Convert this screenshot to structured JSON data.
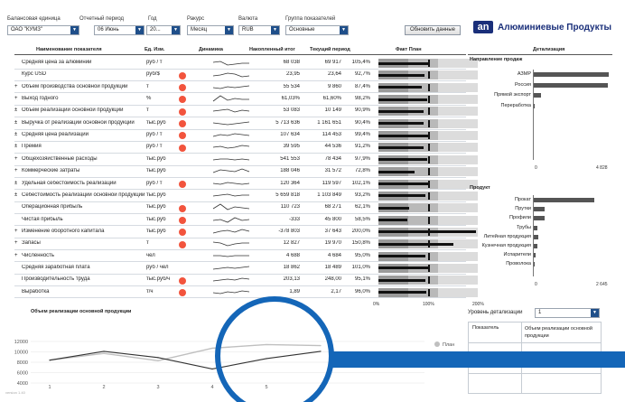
{
  "filters": [
    {
      "label": "Балансовая единица",
      "value": "ОАО \"КУМЗ\""
    },
    {
      "label": "Отчетный период",
      "value": "06 Июнь"
    },
    {
      "label": "Год",
      "value": "20..."
    },
    {
      "label": "Ракурс",
      "value": "Месяц"
    },
    {
      "label": "Валюта",
      "value": "RUB"
    },
    {
      "label": "Группа показателей",
      "value": "Основные"
    }
  ],
  "refresh_button": "Обновить данные",
  "brand": {
    "logo_text": "an",
    "name": "Алюминиевые Продукты"
  },
  "table": {
    "headers": {
      "name": "Наименование показателя",
      "unit": "Ед. Изм.",
      "dynamics": "Динамика",
      "accum": "Накопленный итог",
      "current": "Текущий период",
      "fact_plan": "Факт План"
    },
    "rows": [
      {
        "prefix": "",
        "name": "Средняя цена за алюминий",
        "unit": "руб / т",
        "alert": false,
        "accum": "68 038",
        "current": "69 917",
        "pct": "105,4%",
        "bar": 0.52,
        "target": 0.5,
        "spark": [
          6,
          7,
          3,
          4,
          5,
          5
        ]
      },
      {
        "prefix": "",
        "name": "Курс USD",
        "unit": "руб/$",
        "alert": true,
        "accum": "23,95",
        "current": "23,64",
        "pct": "92,7%",
        "bar": 0.46,
        "target": 0.5,
        "spark": [
          4,
          5,
          7,
          6,
          3,
          4
        ]
      },
      {
        "prefix": "+",
        "name": "Объем производства основной продукции",
        "unit": "т",
        "alert": true,
        "accum": "55 534",
        "current": "9 860",
        "pct": "87,4%",
        "bar": 0.44,
        "target": 0.5,
        "spark": [
          5,
          4,
          6,
          5,
          6,
          7
        ]
      },
      {
        "prefix": "+",
        "name": "Выход годного",
        "unit": "%",
        "alert": true,
        "accum": "61,03%",
        "current": "61,60%",
        "pct": "98,2%",
        "bar": 0.49,
        "target": 0.5,
        "spark": [
          3,
          9,
          4,
          6,
          5,
          5
        ]
      },
      {
        "prefix": "±",
        "name": "Объем реализации основной продукции",
        "unit": "т",
        "alert": true,
        "accum": "53 083",
        "current": "10 149",
        "pct": "90,9%",
        "bar": 0.45,
        "target": 0.5,
        "spark": [
          5,
          6,
          7,
          4,
          6,
          5
        ]
      },
      {
        "prefix": "±",
        "name": "Выручка от реализации основной продукции",
        "unit": "тыс.руб",
        "alert": true,
        "accum": "5 713 636",
        "current": "1 161 651",
        "pct": "90,4%",
        "bar": 0.45,
        "target": 0.5,
        "spark": [
          6,
          5,
          4,
          5,
          6,
          7
        ]
      },
      {
        "prefix": "±",
        "name": "Средняя цена реализации",
        "unit": "руб / т",
        "alert": true,
        "accum": "107 634",
        "current": "114 453",
        "pct": "99,4%",
        "bar": 0.5,
        "target": 0.5,
        "spark": [
          4,
          6,
          5,
          7,
          6,
          5
        ]
      },
      {
        "prefix": "±",
        "name": "Премия",
        "unit": "руб / т",
        "alert": true,
        "accum": "39 595",
        "current": "44 536",
        "pct": "91,2%",
        "bar": 0.45,
        "target": 0.5,
        "spark": [
          5,
          6,
          4,
          5,
          7,
          6
        ]
      },
      {
        "prefix": "+",
        "name": "Общехозяйственные расходы",
        "unit": "тыс.руб",
        "alert": false,
        "accum": "541 553",
        "current": "78 434",
        "pct": "97,9%",
        "bar": 0.49,
        "target": 0.5,
        "spark": [
          5,
          6,
          6,
          5,
          6,
          5
        ]
      },
      {
        "prefix": "+",
        "name": "Коммерческие затраты",
        "unit": "тыс.руб",
        "alert": false,
        "accum": "188 046",
        "current": "31 572",
        "pct": "72,8%",
        "bar": 0.36,
        "target": 0.5,
        "spark": [
          4,
          7,
          6,
          5,
          8,
          5
        ]
      },
      {
        "prefix": "±",
        "name": "Удельная себестоимость реализации",
        "unit": "руб / т",
        "alert": true,
        "accum": "120 364",
        "current": "119 597",
        "pct": "102,1%",
        "bar": 0.51,
        "target": 0.5,
        "spark": [
          6,
          5,
          7,
          6,
          5,
          6
        ]
      },
      {
        "prefix": "±",
        "name": "Себестоимость реализации основной продукции",
        "unit": "тыс.руб",
        "alert": false,
        "accum": "5 659 818",
        "current": "1 103 849",
        "pct": "93,2%",
        "bar": 0.47,
        "target": 0.5,
        "spark": [
          5,
          6,
          7,
          5,
          6,
          6
        ]
      },
      {
        "prefix": "",
        "name": "Операционная прибыль",
        "unit": "тыс.руб",
        "alert": true,
        "accum": "110 723",
        "current": "68 271",
        "pct": "62,1%",
        "bar": 0.31,
        "target": 0.5,
        "spark": [
          4,
          9,
          3,
          6,
          5,
          4
        ]
      },
      {
        "prefix": "",
        "name": "Чистая прибыль",
        "unit": "тыс.руб",
        "alert": true,
        "accum": "-333",
        "current": "45 800",
        "pct": "58,5%",
        "bar": 0.29,
        "target": 0.5,
        "spark": [
          5,
          6,
          3,
          8,
          5,
          6
        ]
      },
      {
        "prefix": "+",
        "name": "Изменение оборотного капитала",
        "unit": "тыс.руб",
        "alert": true,
        "accum": "-378 803",
        "current": "37 643",
        "pct": "200,0%",
        "bar": 0.98,
        "target": 0.5,
        "spark": [
          4,
          6,
          7,
          5,
          8,
          6
        ]
      },
      {
        "prefix": "+",
        "name": "Запасы",
        "unit": "т",
        "alert": true,
        "accum": "12 827",
        "current": "19 970",
        "pct": "150,8%",
        "bar": 0.75,
        "target": 0.5,
        "spark": [
          7,
          6,
          3,
          5,
          6,
          6
        ]
      },
      {
        "prefix": "+",
        "name": "Численность",
        "unit": "чел",
        "alert": false,
        "accum": "4 688",
        "current": "4 684",
        "pct": "95,0%",
        "bar": 0.47,
        "target": 0.5,
        "spark": [
          6,
          6,
          5,
          6,
          6,
          6
        ]
      },
      {
        "prefix": "",
        "name": "Средняя заработная плата",
        "unit": "руб / чел",
        "alert": false,
        "accum": "18 862",
        "current": "18 489",
        "pct": "101,0%",
        "bar": 0.5,
        "target": 0.5,
        "spark": [
          4,
          5,
          6,
          5,
          6,
          7
        ]
      },
      {
        "prefix": "",
        "name": "Производительность труда",
        "unit": "тыс.руб/ч",
        "alert": true,
        "accum": "203,13",
        "current": "248,00",
        "pct": "95,1%",
        "bar": 0.47,
        "target": 0.5,
        "spark": [
          4,
          5,
          6,
          5,
          7,
          6
        ]
      },
      {
        "prefix": "",
        "name": "Выработка",
        "unit": "т/ч",
        "alert": true,
        "accum": "1,89",
        "current": "2,17",
        "pct": "96,0%",
        "bar": 0.48,
        "target": 0.5,
        "spark": [
          5,
          4,
          6,
          5,
          7,
          6
        ]
      }
    ],
    "axis_ticks": [
      "0%",
      "100%",
      "200%"
    ]
  },
  "detail": {
    "title": "Детализация",
    "direction": {
      "title": "Направление продаж",
      "items": [
        {
          "label": "АЗМР",
          "value": 4650
        },
        {
          "label": "Россия",
          "value": 4600
        },
        {
          "label": "Прямой экспорт",
          "value": 430
        },
        {
          "label": "Переработка",
          "value": 30
        }
      ],
      "axis": [
        "0",
        "4 828"
      ]
    },
    "product": {
      "title": "Продукт",
      "items": [
        {
          "label": "Прокат",
          "value": 2050
        },
        {
          "label": "Прутки",
          "value": 380
        },
        {
          "label": "Профили",
          "value": 380
        },
        {
          "label": "Трубы",
          "value": 120
        },
        {
          "label": "Литейная продукция",
          "value": 150
        },
        {
          "label": "Кузнечная продукция",
          "value": 130
        },
        {
          "label": "Испарители",
          "value": 70
        },
        {
          "label": "Проволока",
          "value": 15
        }
      ],
      "axis": [
        "0",
        "2 645"
      ]
    }
  },
  "level": {
    "label": "Уровень детализации",
    "value": "1"
  },
  "mini_table": {
    "col1": "Показатель",
    "col2": "Объем реализации основной продукции"
  },
  "chart_data": {
    "type": "line",
    "title": "Объем реализации основной продукции",
    "x": [
      1,
      2,
      3,
      4,
      5,
      6
    ],
    "ylim": [
      4000,
      12000
    ],
    "yticks": [
      "12000",
      "10000",
      "8000",
      "6000",
      "4000"
    ],
    "series": [
      {
        "name": "План",
        "color": "#bfbfbf",
        "values": [
          8400,
          9700,
          8300,
          10700,
          11400,
          11200
        ]
      },
      {
        "name": "",
        "color": "#333333",
        "values": [
          8400,
          10100,
          8900,
          6700,
          8700,
          10100
        ]
      }
    ]
  },
  "version": "version 1.40"
}
